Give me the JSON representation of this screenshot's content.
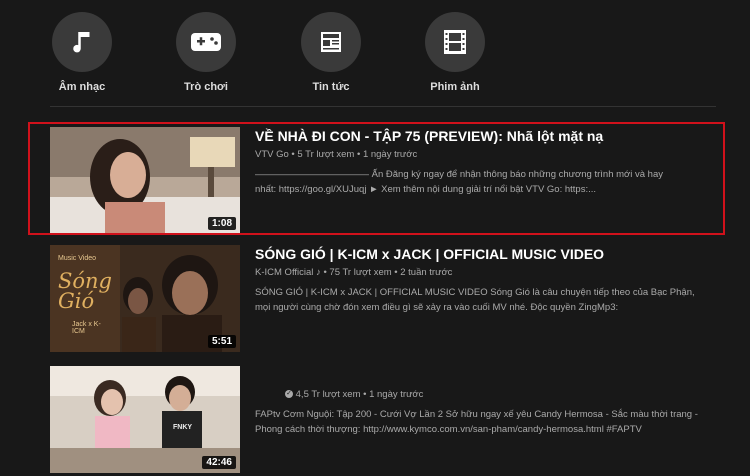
{
  "categories": [
    {
      "label": "Âm nhạc",
      "icon": "music-note-icon"
    },
    {
      "label": "Trò chơi",
      "icon": "gamepad-icon"
    },
    {
      "label": "Tin tức",
      "icon": "newspaper-icon"
    },
    {
      "label": "Phim ảnh",
      "icon": "film-icon"
    }
  ],
  "videos": [
    {
      "title": "VỀ NHÀ ĐI CON - TẬP 75 (PREVIEW): Nhã lột mặt nạ",
      "channel": "VTV Go",
      "stats": "5 Tr lượt xem • 1 ngày trước",
      "desc_line1": "———————————— Ấn Đăng ký ngay để nhận thông báo những chương trình mới và hay",
      "desc_line2": "nhất: https://goo.gl/XUJuqj ► Xem thêm nội dung giải trí nổi bật VTV Go: https:...",
      "duration": "1:08"
    },
    {
      "title": "SÓNG GIÓ | K-ICM x JACK | OFFICIAL MUSIC VIDEO",
      "channel": "K-ICM Official",
      "channel_mark": "♪",
      "stats": "75 Tr lượt xem • 2 tuần trước",
      "desc_line1": "SÓNG GIÓ | K-ICM x JACK | OFFICIAL MUSIC VIDEO Sóng Gió là câu chuyện tiếp theo của Bạc Phận,",
      "desc_line2": "mọi người cùng chờ đón xem điều gì sẽ xảy ra vào cuối MV nhé. Độc quyền ZingMp3:",
      "duration": "5:51",
      "thumb_label": "Music Video",
      "thumb_title": "Sóng Gió",
      "thumb_credit": "Jack x K-ICM"
    },
    {
      "title": "",
      "channel": "",
      "stats": "4,5 Tr lượt xem • 1 ngày trước",
      "desc_line1": "FAPtv Cơm Nguội: Tập 200 - Cưới Vợ Lần 2 Sở hữu ngay xế yêu Candy Hermosa - Sắc màu thời trang -",
      "desc_line2": "Phong cách thời thượng: http://www.kymco.com.vn/san-pham/candy-hermosa.html #FAPTV",
      "duration": "42:46",
      "thumb_shirt": "FNKY"
    }
  ]
}
